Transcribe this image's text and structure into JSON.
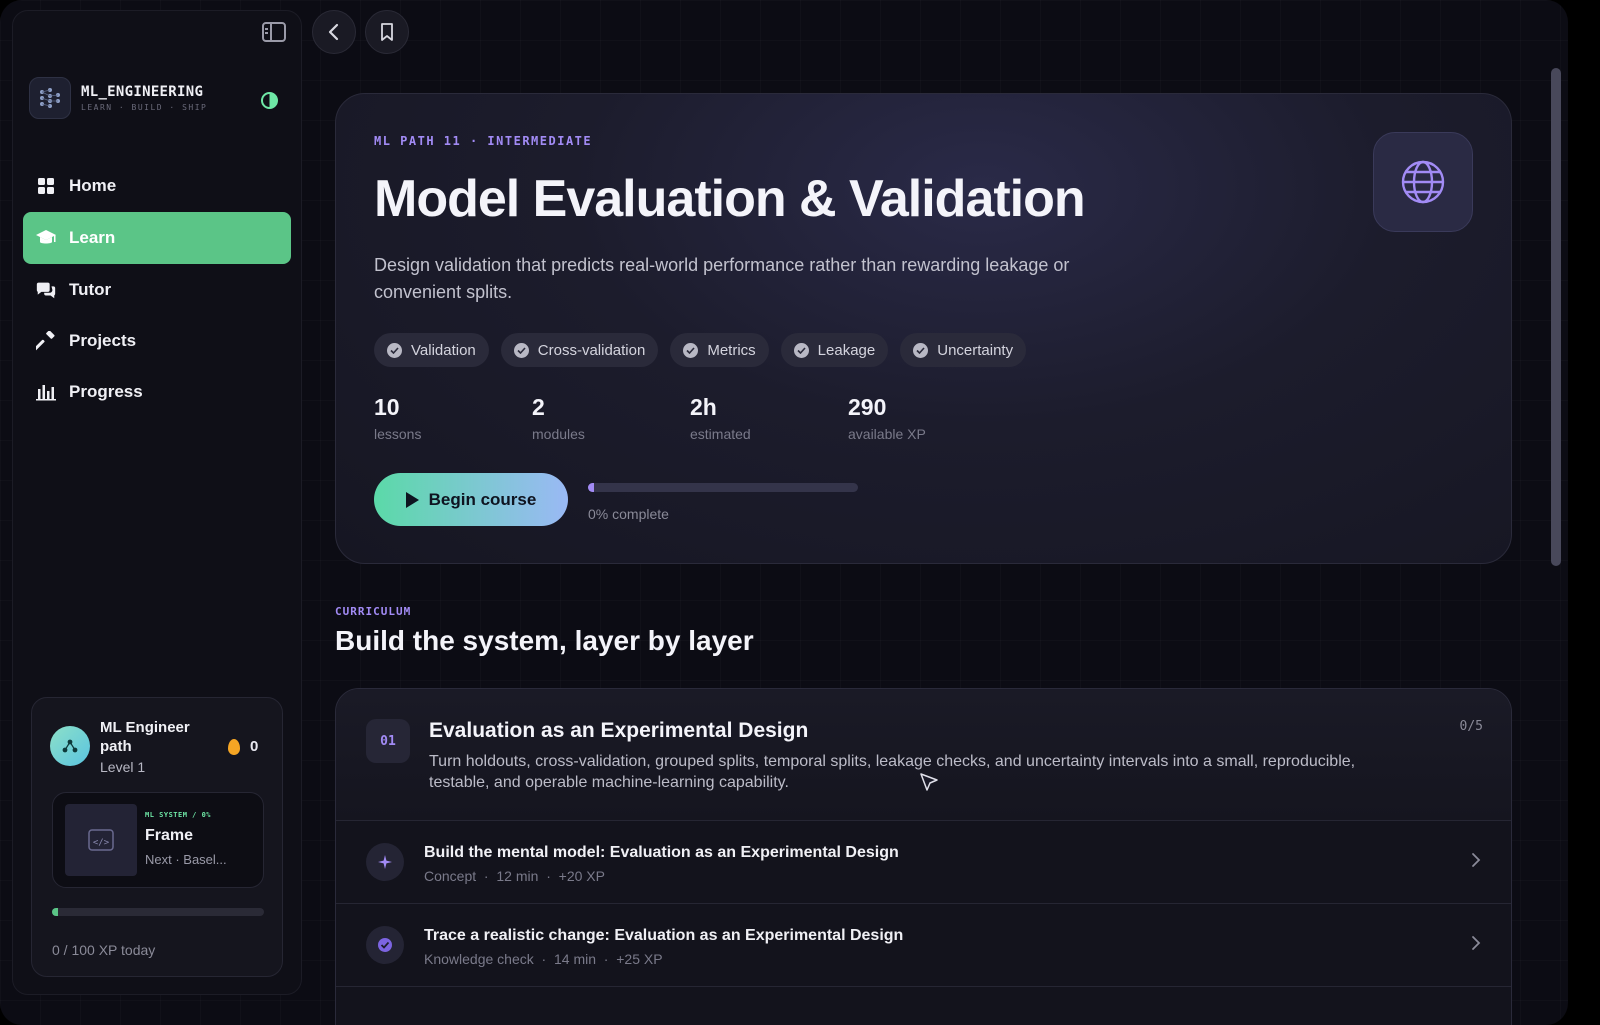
{
  "brand": {
    "title": "ML_ENGINEERING",
    "subtitle": "LEARN · BUILD · SHIP"
  },
  "nav": [
    {
      "label": "Home",
      "icon": "grid-icon",
      "active": false
    },
    {
      "label": "Learn",
      "icon": "graduation-cap-icon",
      "active": true
    },
    {
      "label": "Tutor",
      "icon": "chat-bubbles-icon",
      "active": false
    },
    {
      "label": "Projects",
      "icon": "hammer-icon",
      "active": false
    },
    {
      "label": "Progress",
      "icon": "bar-chart-icon",
      "active": false
    }
  ],
  "path_card": {
    "name": "ML Engineer path",
    "level": "Level 1",
    "streak": "0",
    "frame_kicker": "ML SYSTEM / 0%",
    "frame_title": "Frame",
    "frame_next": "Next · Basel...",
    "xp_text": "0 / 100 XP today",
    "xp_fraction": 0.0
  },
  "hero": {
    "kicker": "ML PATH 11 · INTERMEDIATE",
    "title": "Model Evaluation & Validation",
    "description": "Design validation that predicts real-world performance rather than rewarding leakage or convenient splits.",
    "icon": "globe-icon",
    "tags": [
      "Validation",
      "Cross-validation",
      "Metrics",
      "Leakage",
      "Uncertainty"
    ],
    "stats": [
      {
        "value": "10",
        "label": "lessons"
      },
      {
        "value": "2",
        "label": "modules"
      },
      {
        "value": "2h",
        "label": "estimated"
      },
      {
        "value": "290",
        "label": "available XP"
      }
    ],
    "begin_label": "Begin course",
    "progress_text": "0% complete",
    "progress_fraction": 0.0
  },
  "curriculum": {
    "kicker": "CURRICULUM",
    "title": "Build the system, layer by layer"
  },
  "module": {
    "number": "01",
    "title": "Evaluation as an Experimental Design",
    "count": "0/5",
    "description": "Turn holdouts, cross-validation, grouped splits, temporal splits, leakage checks, and uncertainty intervals into a small, reproducible, testable, and operable machine-learning capability.",
    "lessons": [
      {
        "title": "Build the mental model: Evaluation as an Experimental Design",
        "type": "Concept",
        "duration": "12 min",
        "xp": "+20 XP",
        "icon": "sparkle-icon"
      },
      {
        "title": "Trace a realistic change: Evaluation as an Experimental Design",
        "type": "Knowledge check",
        "duration": "14 min",
        "xp": "+25 XP",
        "icon": "check-badge-icon"
      }
    ]
  },
  "colors": {
    "accent_green": "#5bc587",
    "accent_purple": "#a28bf5",
    "background": "#0c0c14"
  }
}
